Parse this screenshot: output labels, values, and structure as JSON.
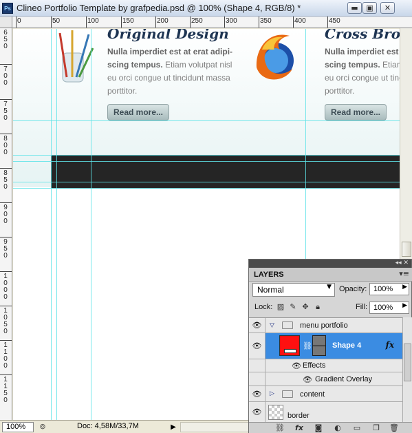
{
  "window": {
    "app_badge": "Ps",
    "title": "Clineo Portfolio Template by grafpedia.psd @ 100% (Shape 4, RGB/8) *",
    "buttons": {
      "minimize": "▬",
      "maximize": "▣",
      "close": "✕"
    }
  },
  "ruler": {
    "h_labels": [
      "0",
      "50",
      "100",
      "150",
      "200",
      "250",
      "300",
      "350",
      "400",
      "450"
    ],
    "v_labels": [
      "650",
      "700",
      "750",
      "800",
      "850",
      "900",
      "950",
      "1000",
      "1050",
      "1100",
      "1150"
    ]
  },
  "canvas": {
    "col1": {
      "heading": "Original Design",
      "bold": "Nulla imperdiet est at erat adipi-scing tempus.",
      "text": " Etiam volutpat nisl eu orci congue ut tincidunt massa porttitor.",
      "button": "Read more..."
    },
    "col2": {
      "heading": "Cross Brows",
      "bold": "Nulla imperdiet est at erat adipi-scing tempus.",
      "text": " Etiam volutpat nisl eu orci congue ut tincidunt massa porttitor.",
      "button": "Read more..."
    }
  },
  "status": {
    "zoom": "100%",
    "doc": "Doc: 4,58M/33,7M",
    "arrow": "▶"
  },
  "layers": {
    "tab": "LAYERS",
    "blend_mode": "Normal",
    "opacity_label": "Opacity:",
    "opacity": "100%",
    "lock_label": "Lock:",
    "fill_label": "Fill:",
    "fill": "100%",
    "rows": {
      "menu_portfolio": "menu portfolio",
      "shape4": "Shape 4",
      "effects": "Effects",
      "gradient_overlay": "Gradient Overlay",
      "content": "content",
      "border": "border"
    }
  },
  "colors": {
    "accent": "#3b8ce2",
    "guide": "#5ee3e8",
    "menu_bar": "#252525",
    "shape_fill": "#ff1010"
  }
}
